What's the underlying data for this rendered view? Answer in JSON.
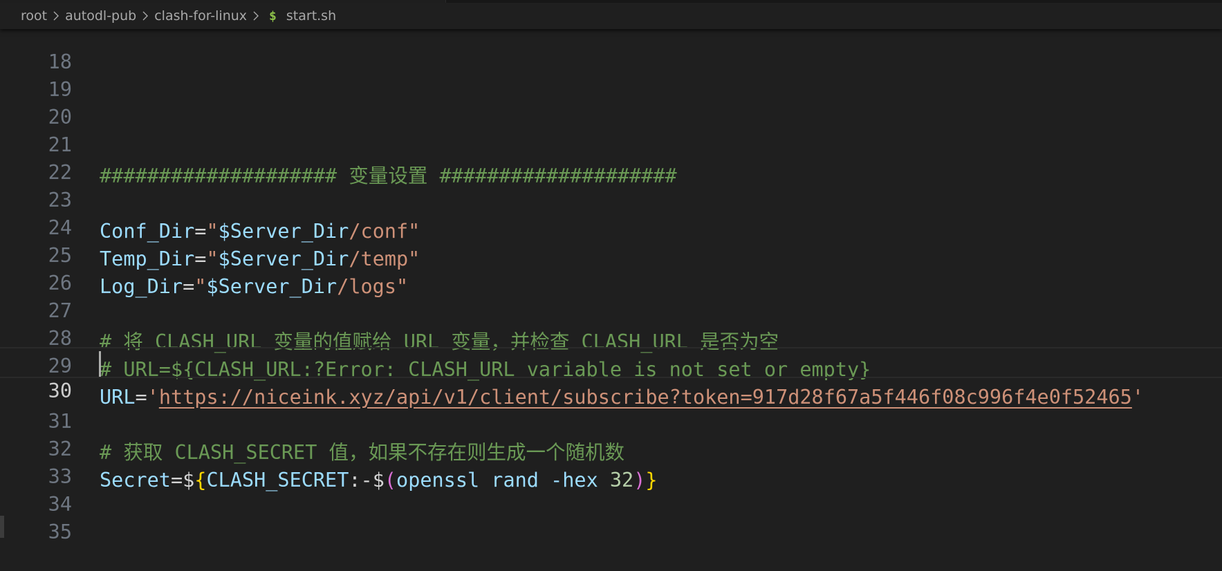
{
  "breadcrumb": {
    "items": [
      "root",
      "autodl-pub",
      "clash-for-linux"
    ],
    "file_icon": "$",
    "file_name": "start.sh"
  },
  "editor": {
    "language": "shell",
    "active_line": "30",
    "lines": [
      {
        "num": "18",
        "text": ""
      },
      {
        "num": "19",
        "text": ""
      },
      {
        "num": "20",
        "text": ""
      },
      {
        "num": "21",
        "text": "#################### 变量设置 ####################"
      },
      {
        "num": "22",
        "text": ""
      },
      {
        "num": "23",
        "text": "Conf_Dir=\"$Server_Dir/conf\""
      },
      {
        "num": "24",
        "text": "Temp_Dir=\"$Server_Dir/temp\""
      },
      {
        "num": "25",
        "text": "Log_Dir=\"$Server_Dir/logs\""
      },
      {
        "num": "26",
        "text": ""
      },
      {
        "num": "27",
        "text": "# 将 CLASH_URL 变量的值赋给 URL 变量，并检查 CLASH_URL 是否为空"
      },
      {
        "num": "28",
        "text": "# URL=${CLASH_URL:?Error: CLASH_URL variable is not set or empty}"
      },
      {
        "num": "29",
        "text": "URL='https://niceink.xyz/api/v1/client/subscribe?token=917d28f67a5f446f08c996f4e0f52465'"
      },
      {
        "num": "30",
        "text": ""
      },
      {
        "num": "31",
        "text": "# 获取 CLASH_SECRET 值，如果不存在则生成一个随机数"
      },
      {
        "num": "32",
        "text": "Secret=${CLASH_SECRET:-$(openssl rand -hex 32)}"
      },
      {
        "num": "33",
        "text": ""
      },
      {
        "num": "34",
        "text": ""
      },
      {
        "num": "35",
        "text": ""
      }
    ],
    "tokens": {
      "l21": "#################### 变量设置 ####################",
      "l23_var": "Conf_Dir",
      "l23_eq": "=",
      "l23_q1": "\"",
      "l23_ref": "$Server_Dir",
      "l23_path": "/conf",
      "l23_q2": "\"",
      "l24_var": "Temp_Dir",
      "l24_eq": "=",
      "l24_q1": "\"",
      "l24_ref": "$Server_Dir",
      "l24_path": "/temp",
      "l24_q2": "\"",
      "l25_var": "Log_Dir",
      "l25_eq": "=",
      "l25_q1": "\"",
      "l25_ref": "$Server_Dir",
      "l25_path": "/logs",
      "l25_q2": "\"",
      "l27": "# 将 CLASH_URL 变量的值赋给 URL 变量，并检查 CLASH_URL 是否为空",
      "l28": "# URL=${CLASH_URL:?Error: CLASH_URL variable is not set or empty}",
      "l29_var": "URL",
      "l29_eq": "=",
      "l29_q1": "'",
      "l29_url": "https://niceink.xyz/api/v1/client/subscribe?token=917d28f67a5f446f08c996f4e0f52465",
      "l29_q2": "'",
      "l31": "# 获取 CLASH_SECRET 值，如果不存在则生成一个随机数",
      "l32_var": "Secret",
      "l32_eq": "=",
      "l32_dollar": "$",
      "l32_brace_open": "{",
      "l32_name": "CLASH_SECRET",
      "l32_default": ":-$",
      "l32_paren_open": "(",
      "l32_cmd": "openssl rand -hex ",
      "l32_num": "32",
      "l32_paren_close": ")",
      "l32_brace_close": "}"
    }
  },
  "colors": {
    "background": "#1f1f1f",
    "comment": "#6a9955",
    "variable": "#9cdcfe",
    "string": "#ce9178",
    "line_number": "#6e7681",
    "line_number_active": "#cccccc"
  }
}
